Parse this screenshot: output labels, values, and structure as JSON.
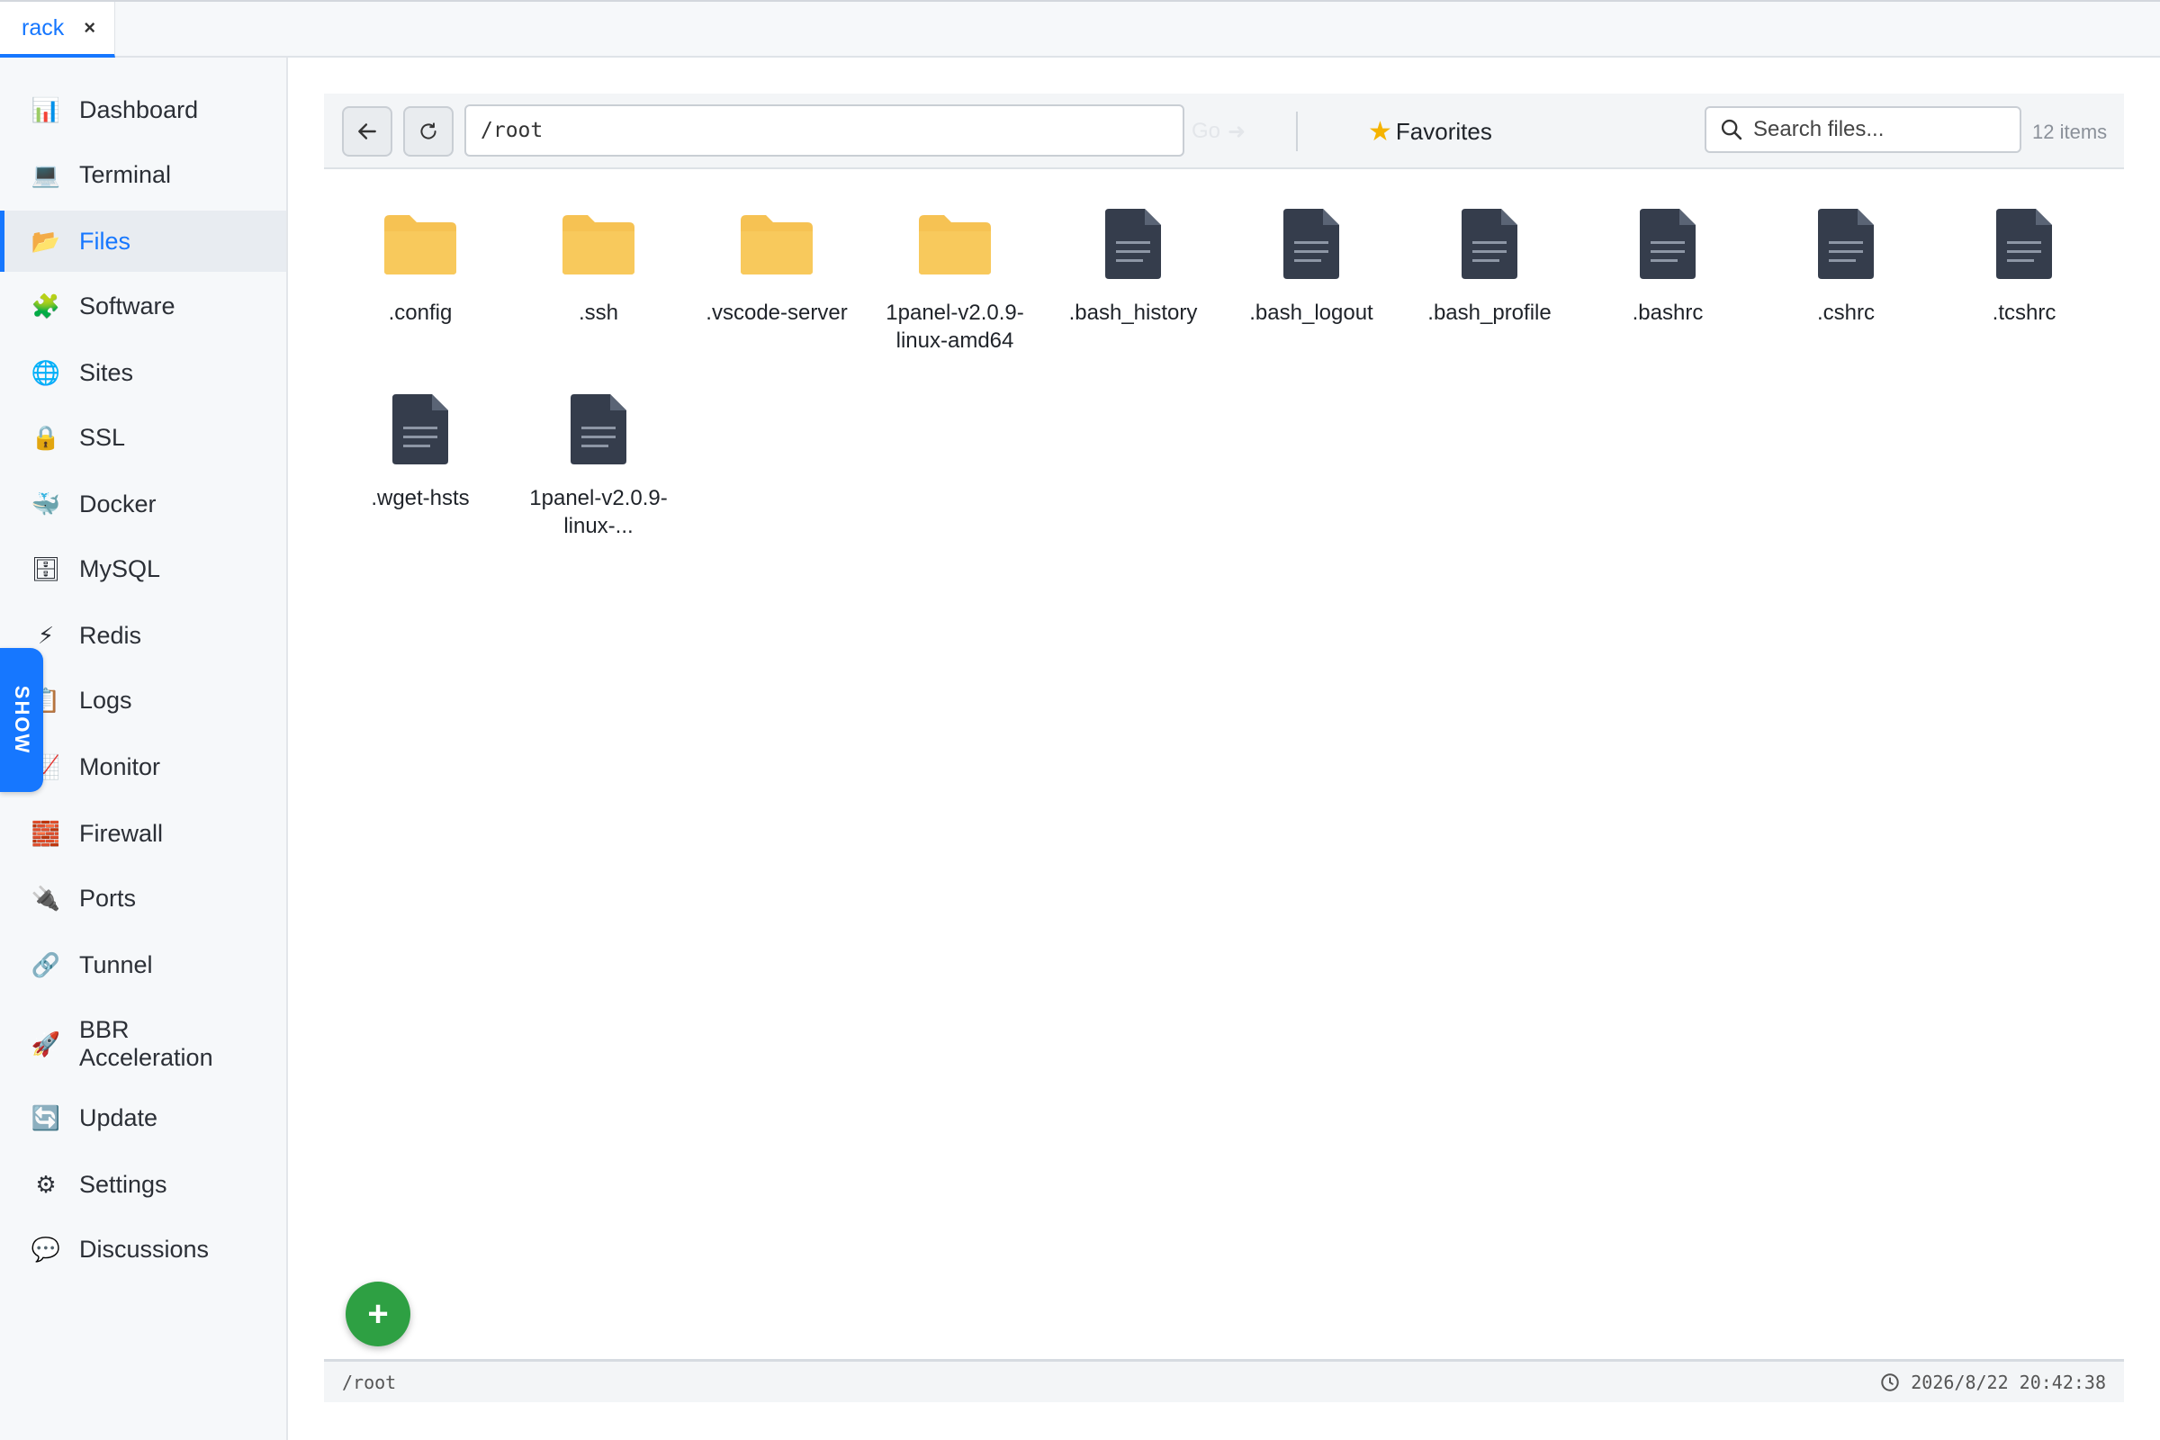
{
  "tabs": [
    {
      "label": "rack",
      "close": "×"
    }
  ],
  "sidebar": {
    "items": [
      {
        "label": "Dashboard",
        "icon": "📊"
      },
      {
        "label": "Terminal",
        "icon": "💻"
      },
      {
        "label": "Files",
        "icon": "📂",
        "active": true
      },
      {
        "label": "Software",
        "icon": "🧩"
      },
      {
        "label": "Sites",
        "icon": "🌐"
      },
      {
        "label": "SSL",
        "icon": "🔒"
      },
      {
        "label": "Docker",
        "icon": "🐳"
      },
      {
        "label": "MySQL",
        "icon": "🗄"
      },
      {
        "label": "Redis",
        "icon": "⚡"
      },
      {
        "label": "Logs",
        "icon": "📋"
      },
      {
        "label": "Monitor",
        "icon": "📈"
      },
      {
        "label": "Firewall",
        "icon": "🧱"
      },
      {
        "label": "Ports",
        "icon": "🔌"
      },
      {
        "label": "Tunnel",
        "icon": "🔗"
      },
      {
        "label": "BBR\nAcceleration",
        "icon": "🚀"
      },
      {
        "label": "Update",
        "icon": "🔄"
      },
      {
        "label": "Settings",
        "icon": "⚙"
      },
      {
        "label": "Discussions",
        "icon": "💬"
      }
    ],
    "show_tab": "SHOW"
  },
  "toolbar": {
    "path_value": "/root",
    "go_label": "Go",
    "favorites_label": "Favorites",
    "search_placeholder": "Search files...",
    "item_count": "12 items"
  },
  "files": [
    {
      "name": ".config",
      "type": "folder"
    },
    {
      "name": ".ssh",
      "type": "folder"
    },
    {
      "name": ".vscode-server",
      "type": "folder"
    },
    {
      "name": "1panel-v2.0.9-linux-amd64",
      "type": "folder"
    },
    {
      "name": ".bash_history",
      "type": "file"
    },
    {
      "name": ".bash_logout",
      "type": "file"
    },
    {
      "name": ".bash_profile",
      "type": "file"
    },
    {
      "name": ".bashrc",
      "type": "file"
    },
    {
      "name": ".cshrc",
      "type": "file"
    },
    {
      "name": ".tcshrc",
      "type": "file"
    },
    {
      "name": ".wget-hsts",
      "type": "file"
    },
    {
      "name": "1panel-v2.0.9-linux-...",
      "type": "file"
    }
  ],
  "fab_label": "+",
  "statusbar": {
    "path": "/root",
    "datetime": "2026/8/22 20:42:38"
  },
  "colors": {
    "accent": "#1677ff",
    "folder": "#f6c253",
    "file": "#353d4c",
    "fab": "#2ea043"
  }
}
